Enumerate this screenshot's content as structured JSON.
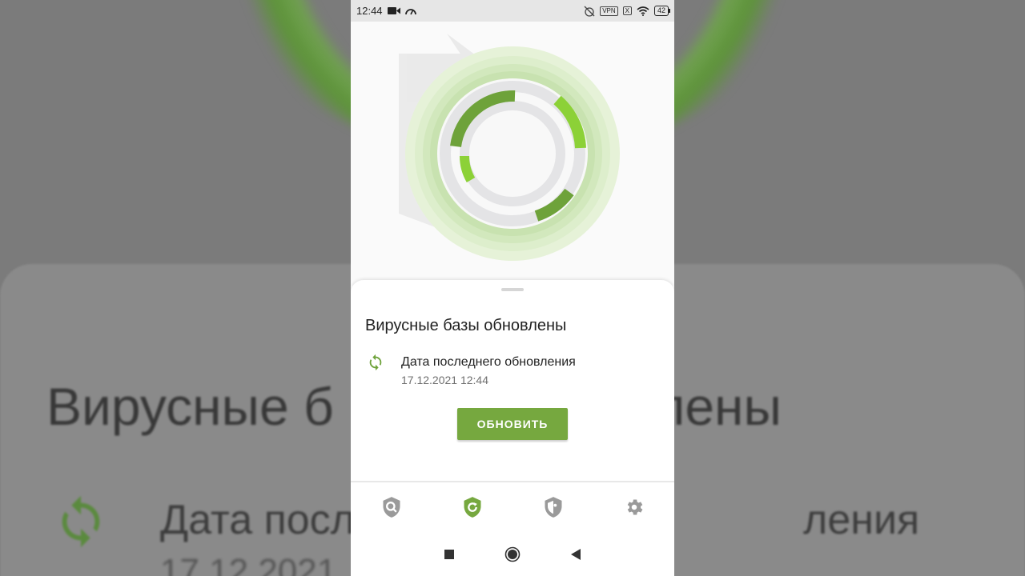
{
  "status_bar": {
    "time": "12:44",
    "vpn_label": "VPN",
    "x_label": "X",
    "battery_level": "42"
  },
  "sheet": {
    "title": "Вирусные базы обновлены",
    "update_label": "Дата последнего обновления",
    "update_date": "17.12.2021 12:44",
    "button_label": "ОБНОВИТЬ"
  },
  "background": {
    "title_fragment_1": "Вирусные б",
    "title_fragment_2": "лены",
    "sub_fragment_1": "Дата посл",
    "sub_fragment_2": "ления",
    "date_fragment": "17.12.2021"
  },
  "bottom_nav": {
    "items": [
      {
        "icon": "shield-search-icon",
        "active": false
      },
      {
        "icon": "shield-update-icon",
        "active": true
      },
      {
        "icon": "shield-puzzle-icon",
        "active": false
      },
      {
        "icon": "gear-icon",
        "active": false
      }
    ]
  },
  "colors": {
    "accent": "#76a83f",
    "accent_light": "#8cd137",
    "inactive_icon": "#9a9a9a"
  }
}
